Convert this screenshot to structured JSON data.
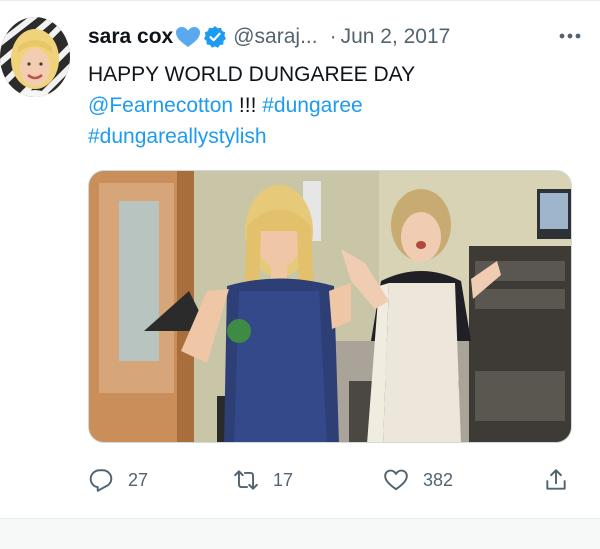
{
  "tweet": {
    "author_name": "sara cox",
    "author_handle": "@saraj...",
    "separator": "·",
    "date": "Jun 2, 2017",
    "text_line1": "HAPPY WORLD DUNGAREE DAY",
    "mention": "@Fearnecotton",
    "exclaim": " !!! ",
    "hashtag1": "#dungaree",
    "hashtag2": "#dungareallystylish"
  },
  "actions": {
    "reply_count": "27",
    "retweet_count": "17",
    "like_count": "382"
  },
  "icons": {
    "avatar": "avatar-photo",
    "heart_emoji": "blue-heart-icon",
    "verified": "verified-badge-icon",
    "more": "more-icon",
    "reply": "reply-icon",
    "retweet": "retweet-icon",
    "like": "like-icon",
    "share": "share-icon"
  },
  "colors": {
    "link": "#1d9bf0",
    "secondary_text": "#536471",
    "verified": "#1d9bf0",
    "heart_emoji": "#5aa9f0"
  }
}
